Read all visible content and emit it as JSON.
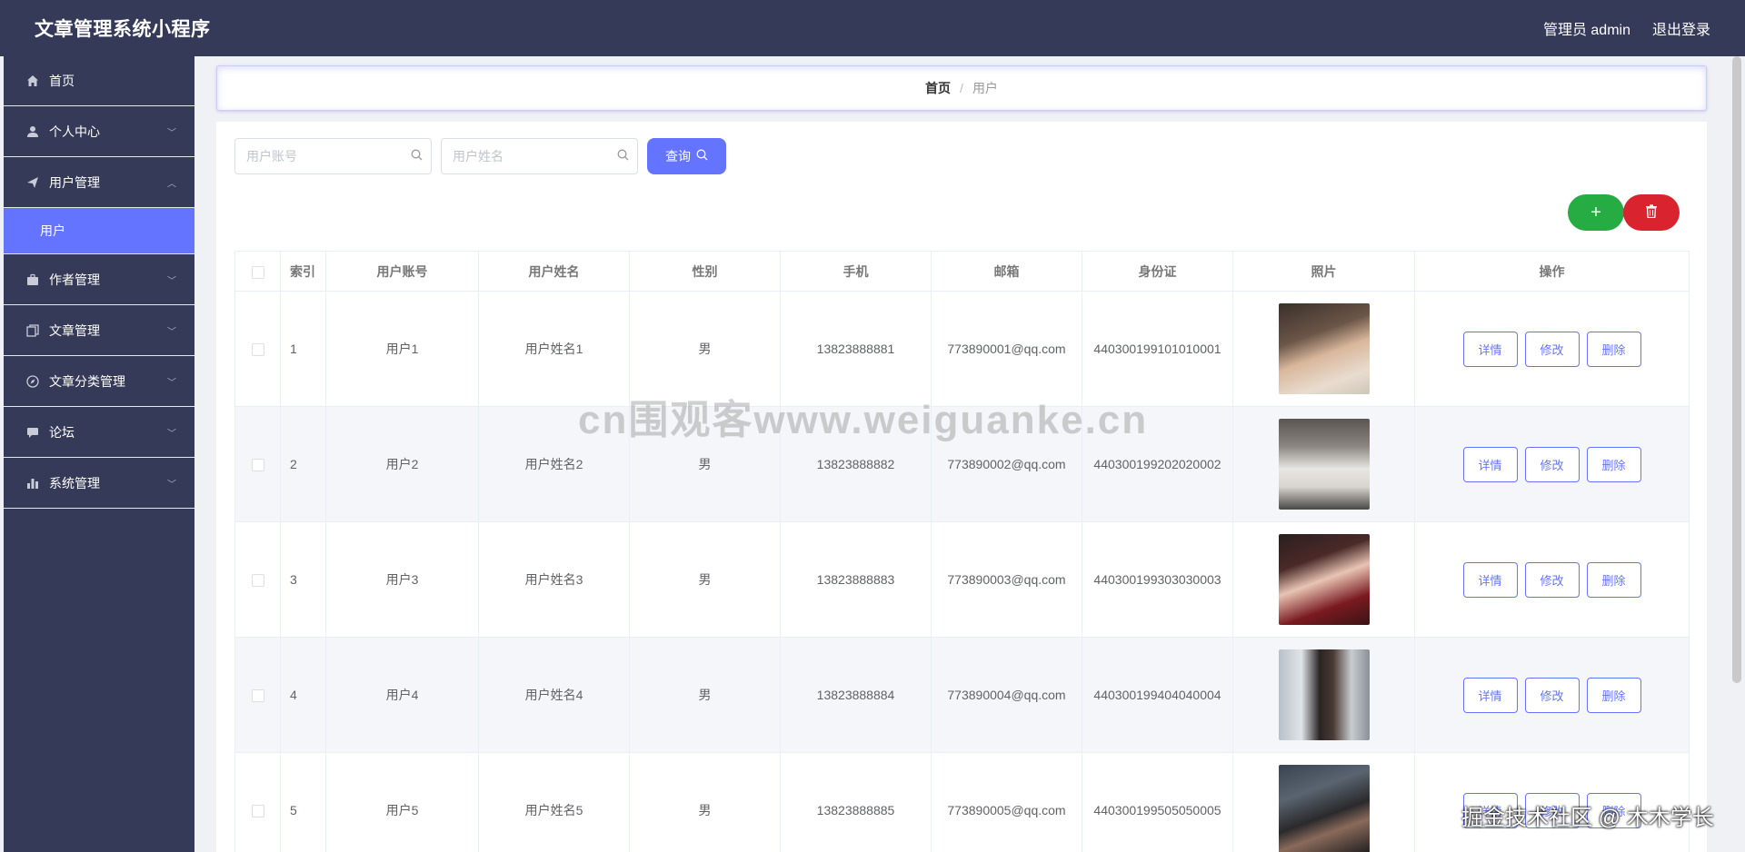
{
  "header": {
    "app_title": "文章管理系统小程序",
    "admin_label": "管理员 admin",
    "logout_label": "退出登录"
  },
  "sidebar": {
    "items": [
      {
        "label": "首页",
        "icon": "home-icon"
      },
      {
        "label": "个人中心",
        "icon": "user-icon",
        "expanded": false
      },
      {
        "label": "用户管理",
        "icon": "send-icon",
        "expanded": true,
        "children": [
          {
            "label": "用户",
            "active": true
          }
        ]
      },
      {
        "label": "作者管理",
        "icon": "briefcase-icon",
        "expanded": false
      },
      {
        "label": "文章管理",
        "icon": "copy-icon",
        "expanded": false
      },
      {
        "label": "文章分类管理",
        "icon": "compass-icon",
        "expanded": false
      },
      {
        "label": "论坛",
        "icon": "chat-icon",
        "expanded": false
      },
      {
        "label": "系统管理",
        "icon": "bar-chart-icon",
        "expanded": false
      }
    ]
  },
  "breadcrumb": {
    "home": "首页",
    "separator": "/",
    "current": "用户"
  },
  "search": {
    "account_placeholder": "用户账号",
    "name_placeholder": "用户姓名",
    "query_label": "查询"
  },
  "actions": {
    "add_label": "+",
    "delete_icon": "trash-icon"
  },
  "table": {
    "headers": [
      "索引",
      "用户账号",
      "用户姓名",
      "性别",
      "手机",
      "邮箱",
      "身份证",
      "照片",
      "操作"
    ],
    "rows": [
      {
        "index": "1",
        "account": "用户1",
        "name": "用户姓名1",
        "gender": "男",
        "phone": "13823888881",
        "email": "773890001@qq.com",
        "idcard": "440300199101010001"
      },
      {
        "index": "2",
        "account": "用户2",
        "name": "用户姓名2",
        "gender": "男",
        "phone": "13823888882",
        "email": "773890002@qq.com",
        "idcard": "440300199202020002"
      },
      {
        "index": "3",
        "account": "用户3",
        "name": "用户姓名3",
        "gender": "男",
        "phone": "13823888883",
        "email": "773890003@qq.com",
        "idcard": "440300199303030003"
      },
      {
        "index": "4",
        "account": "用户4",
        "name": "用户姓名4",
        "gender": "男",
        "phone": "13823888884",
        "email": "773890004@qq.com",
        "idcard": "440300199404040004"
      },
      {
        "index": "5",
        "account": "用户5",
        "name": "用户姓名5",
        "gender": "男",
        "phone": "13823888885",
        "email": "773890005@qq.com",
        "idcard": "440300199505050005"
      }
    ],
    "op_labels": {
      "detail": "详情",
      "edit": "修改",
      "delete": "删除"
    }
  },
  "overlays": {
    "watermark": "cn围观客www.weiguanke.cn",
    "corner_mark": "掘金技术社区 @ 木木学长"
  },
  "colors": {
    "header_bg": "#353a58",
    "accent": "#6474ff",
    "add_button": "#25ad44",
    "delete_button": "#d9232f"
  }
}
